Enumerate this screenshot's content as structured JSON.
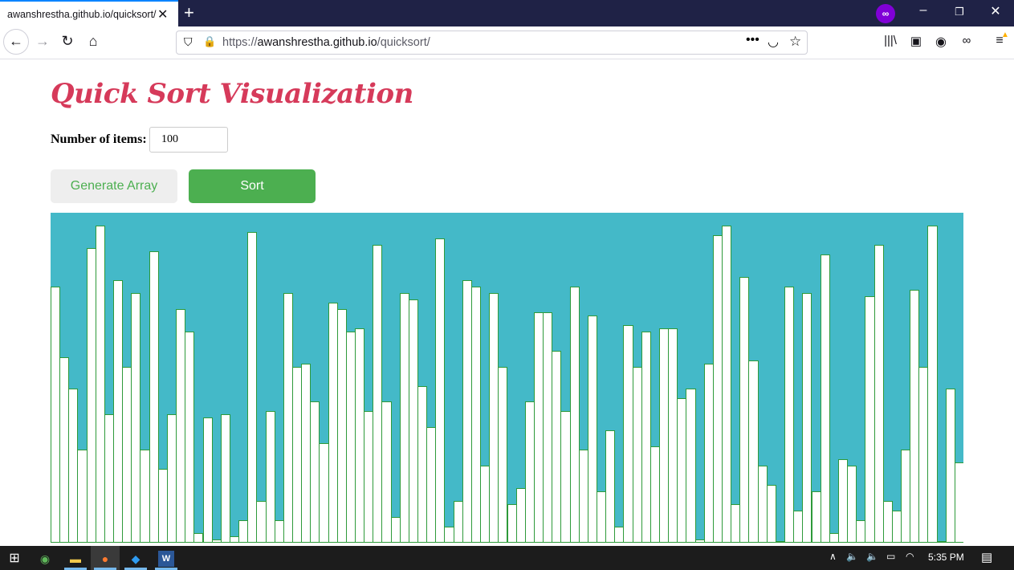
{
  "browser": {
    "tab_title": "awanshrestha.github.io/quicksort/",
    "url_prefix": "https://",
    "url_domain": "awanshrestha.github.io",
    "url_path": "/quicksort/"
  },
  "page": {
    "title": "Quick Sort Visualization",
    "items_label": "Number of items:",
    "items_value": "100",
    "generate_label": "Generate Array",
    "sort_label": "Sort"
  },
  "colors": {
    "chart_bg": "#44b9c8",
    "bar_fill": "#ffffff",
    "bar_border": "#2e9a3a",
    "title": "#d63a5a",
    "button_green": "#4caf50"
  },
  "chart_data": {
    "type": "bar",
    "title": "",
    "xlabel": "",
    "ylabel": "",
    "ylim": [
      0,
      100
    ],
    "values": [
      80,
      58,
      48,
      29,
      92,
      99,
      40,
      82,
      55,
      78,
      29,
      91,
      23,
      40,
      73,
      66,
      3,
      39,
      1,
      40,
      2,
      7,
      97,
      13,
      41,
      7,
      78,
      55,
      56,
      44,
      31,
      75,
      73,
      66,
      67,
      41,
      93,
      44,
      8,
      78,
      76,
      49,
      36,
      95,
      5,
      13,
      82,
      80,
      24,
      78,
      55,
      12,
      17,
      44,
      72,
      72,
      60,
      41,
      80,
      29,
      71,
      16,
      35,
      5,
      68,
      55,
      66,
      30,
      67,
      67,
      45,
      48,
      1,
      56,
      96,
      99,
      12,
      83,
      57,
      24,
      18,
      0,
      80,
      10,
      78,
      16,
      90,
      3,
      26,
      24,
      7,
      77,
      93,
      13,
      10,
      29,
      79,
      55,
      99,
      0,
      48,
      25
    ],
    "values_note": ""
  },
  "taskbar": {
    "time": "5:35 PM"
  }
}
